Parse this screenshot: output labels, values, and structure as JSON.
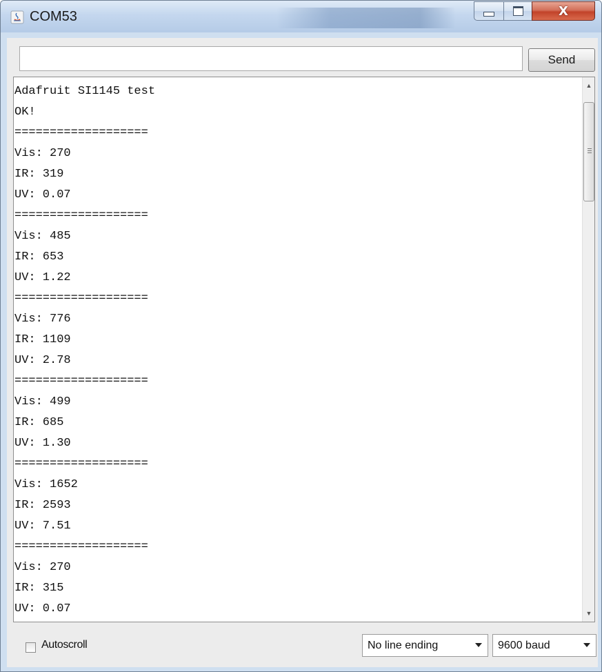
{
  "window": {
    "title": "COM53",
    "controls": [
      "minimize-icon",
      "maximize-icon",
      "close-icon"
    ]
  },
  "send": {
    "input_value": "",
    "button_label": "Send"
  },
  "output": {
    "lines": [
      "Adafruit SI1145 test",
      "OK!",
      "===================",
      "Vis: 270",
      "IR: 319",
      "UV: 0.07",
      "===================",
      "Vis: 485",
      "IR: 653",
      "UV: 1.22",
      "===================",
      "Vis: 776",
      "IR: 1109",
      "UV: 2.78",
      "===================",
      "Vis: 499",
      "IR: 685",
      "UV: 1.30",
      "===================",
      "Vis: 1652",
      "IR: 2593",
      "UV: 7.51",
      "===================",
      "Vis: 270",
      "IR: 315",
      "UV: 0.07",
      "==================="
    ]
  },
  "footer": {
    "autoscroll_label": "Autoscroll",
    "autoscroll_checked": false,
    "line_ending_selected": "No line ending",
    "baud_selected": "9600 baud"
  },
  "colors": {
    "title_bar": "#c4d7ee",
    "close_button": "#c2432a",
    "client_bg": "#ececec"
  }
}
